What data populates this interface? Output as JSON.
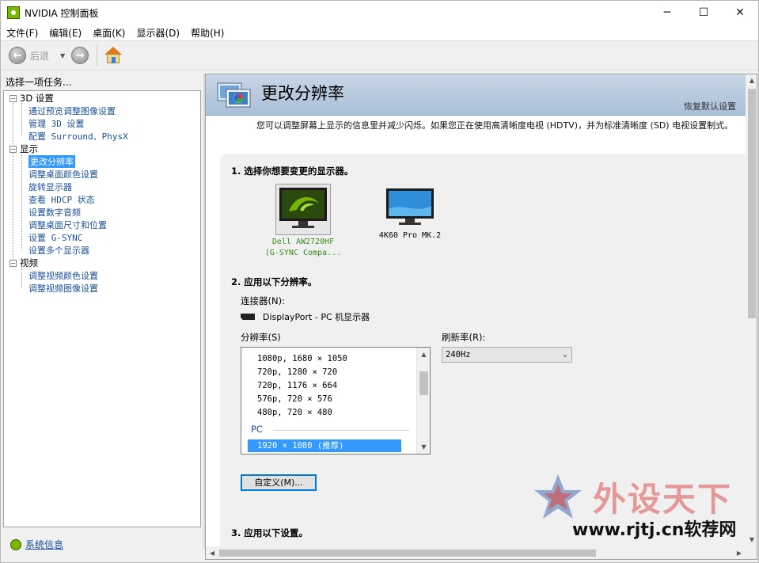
{
  "window": {
    "title": "NVIDIA 控制面板",
    "minimize_glyph": "─",
    "maximize_glyph": "☐",
    "close_glyph": "✕"
  },
  "menu": [
    "文件(F)",
    "编辑(E)",
    "桌面(K)",
    "显示器(D)",
    "帮助(H)"
  ],
  "toolbar": {
    "back_label": "后退",
    "back_icon": "arrow-left-icon",
    "forward_icon": "arrow-right-icon",
    "home_icon": "home-icon"
  },
  "sidebar": {
    "heading": "选择一项任务...",
    "categories": [
      {
        "label": "3D 设置",
        "items": [
          "通过预览调整图像设置",
          "管理 3D 设置",
          "配置 Surround、PhysX"
        ]
      },
      {
        "label": "显示",
        "items": [
          "更改分辨率",
          "调整桌面颜色设置",
          "旋转显示器",
          "查看 HDCP 状态",
          "设置数字音频",
          "调整桌面尺寸和位置",
          "设置 G-SYNC",
          "设置多个显示器"
        ]
      },
      {
        "label": "视频",
        "items": [
          "调整视频颜色设置",
          "调整视频图像设置"
        ]
      }
    ],
    "selected_item": "更改分辨率",
    "expander_glyph": "−",
    "system_info": "系统信息"
  },
  "main": {
    "title": "更改分辨率",
    "restore_defaults": "恢复默认设置",
    "description": "您可以调整屏幕上显示的信息里并减少闪烁。如果您正在使用高清晰度电视 (HDTV)，并为标准清晰度 (SD) 电视设置制式。",
    "section1": "1. 选择你想要变更的显示器。",
    "monitors": [
      {
        "caption_line1": "Dell AW2720HF",
        "caption_line2": "(G-SYNC Compa...",
        "selected": true
      },
      {
        "caption_line1": "4K60 Pro MK.2",
        "caption_line2": "",
        "selected": false
      }
    ],
    "section2": "2. 应用以下分辨率。",
    "connector_label": "连接器(N):",
    "connector_value": "DisplayPort - PC 机显示器",
    "resolution_label": "分辨率(S)",
    "resolutions": [
      "1080p, 1680 × 1050",
      "720p, 1280 × 720",
      "720p, 1176 × 664",
      "576p, 720 × 576",
      "480p, 720 × 480"
    ],
    "pc_group": "PC",
    "selected_resolution": "1920 × 1080 (推荐)",
    "refresh_label": "刷新率(R):",
    "refresh_value": "240Hz",
    "custom_button": "自定义(M)...",
    "section3": "3. 应用以下设置。"
  },
  "watermark": {
    "brand": "外设天下",
    "url": "www.rjtj.cn软荐网"
  },
  "colors": {
    "banner": "#a9bfd7",
    "selection": "#3399ff",
    "link": "#1a4f9c",
    "nvidia_green": "#76b900"
  }
}
